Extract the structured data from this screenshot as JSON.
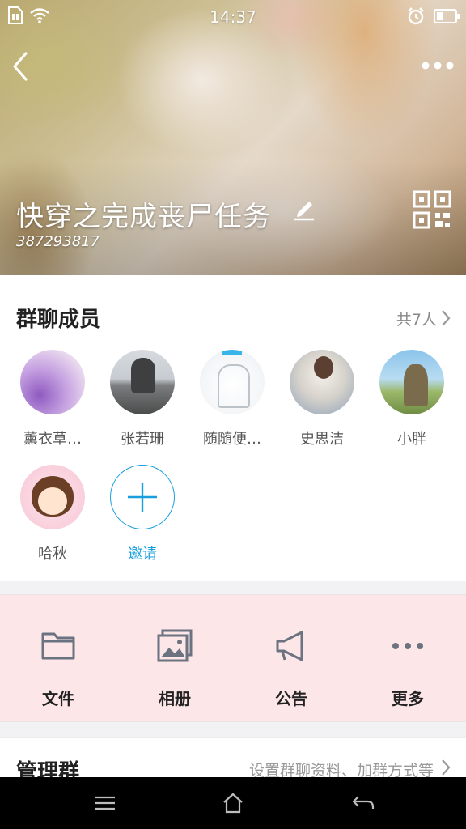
{
  "status_bar": {
    "time": "14:37"
  },
  "header": {
    "group_name": "快穿之完成丧尸任务",
    "group_id": "387293817"
  },
  "members": {
    "title": "群聊成员",
    "count": "共7人",
    "list": [
      {
        "name": "薰衣草…"
      },
      {
        "name": "张若珊"
      },
      {
        "name": "随随便…"
      },
      {
        "name": "史思洁"
      },
      {
        "name": "小胖"
      },
      {
        "name": "哈秋"
      }
    ],
    "invite_label": "邀请"
  },
  "actions": [
    {
      "label": "文件",
      "icon": "folder-icon"
    },
    {
      "label": "相册",
      "icon": "photo-album-icon"
    },
    {
      "label": "公告",
      "icon": "megaphone-icon"
    },
    {
      "label": "更多",
      "icon": "more-dots-icon"
    }
  ],
  "manage": {
    "title": "管理群",
    "subtitle": "设置群聊资料、加群方式等"
  },
  "colors": {
    "accent": "#1a9fde",
    "actions_bg": "#fde6e8",
    "navbar_bg": "#000000"
  }
}
